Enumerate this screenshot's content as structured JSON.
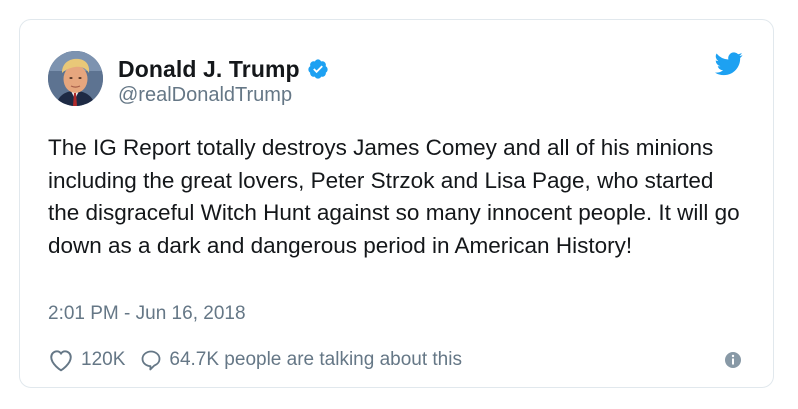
{
  "tweet": {
    "display_name": "Donald J. Trump",
    "handle": "@realDonaldTrump",
    "text": "The IG Report totally destroys James Comey and all of his minions including the great lovers, Peter Strzok and Lisa Page, who started the disgraceful Witch Hunt against so many innocent people. It will go down as a dark and dangerous period in American History!",
    "timestamp": "2:01 PM - Jun 16, 2018",
    "like_count": "120K",
    "talking_text": "64.7K people are talking about this"
  },
  "icons": {
    "verified": "verified-badge-icon",
    "brand": "twitter-bird-icon",
    "like": "heart-icon",
    "reply": "speech-bubble-icon",
    "info": "info-icon"
  },
  "colors": {
    "brand_blue": "#1da1f2",
    "text_primary": "#14171a",
    "text_secondary": "#657786",
    "border": "#e1e8ed"
  }
}
